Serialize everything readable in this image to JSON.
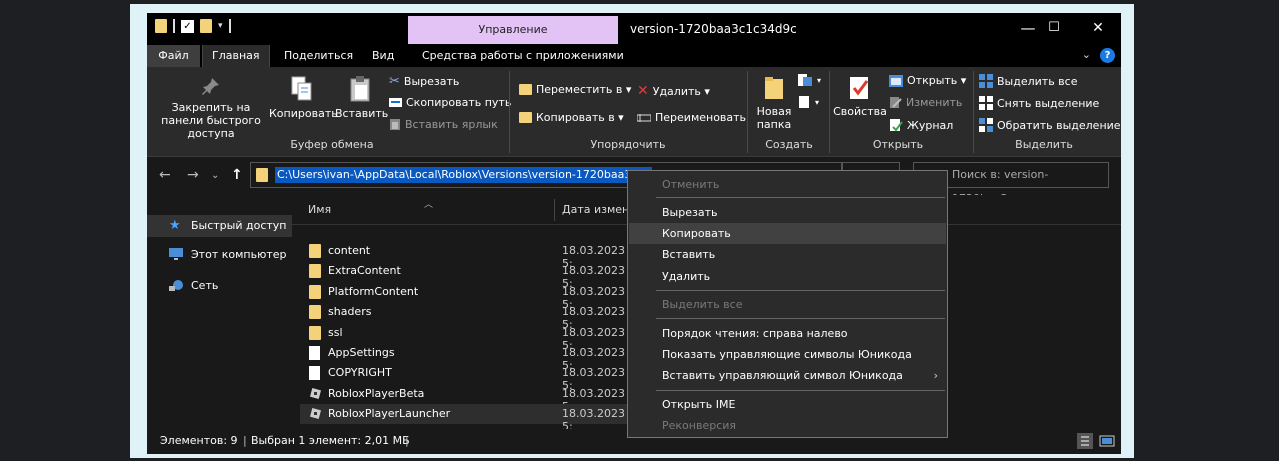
{
  "window": {
    "title": "version-1720baa3c1c34d9c",
    "context_tab_header": "Управление",
    "controls": {
      "minimize": "—",
      "maximize": "☐",
      "close": "✕"
    }
  },
  "tabs": [
    {
      "label": "Файл"
    },
    {
      "label": "Главная"
    },
    {
      "label": "Поделиться"
    },
    {
      "label": "Вид"
    },
    {
      "label": "Средства работы с приложениями"
    }
  ],
  "ribbon": {
    "clipboard": {
      "label": "Буфер обмена",
      "pin": "Закрепить на панели быстрого доступа",
      "copy": "Копировать",
      "paste": "Вставить",
      "cut": "Вырезать",
      "copy_path": "Скопировать путь",
      "paste_shortcut": "Вставить ярлык"
    },
    "organize": {
      "label": "Упорядочить",
      "move_to": "Переместить в ▾",
      "copy_to": "Копировать в ▾",
      "delete": "Удалить ▾",
      "rename": "Переименовать"
    },
    "new": {
      "label": "Создать",
      "new_folder": "Новая папка"
    },
    "open": {
      "label": "Открыть",
      "properties": "Свойства",
      "open": "Открыть ▾",
      "edit": "Изменить",
      "history": "Журнал"
    },
    "select": {
      "label": "Выделить",
      "select_all": "Выделить все",
      "select_none": "Снять выделение",
      "invert": "Обратить выделение"
    }
  },
  "address": {
    "path": "C:\\Users\\ivan-\\AppData\\Local\\Roblox\\Versions\\version-1720baa3c1c",
    "search_placeholder": "Поиск в: version-1720baa3c..."
  },
  "nav_pane": [
    {
      "label": "Быстрый доступ",
      "icon": "star-icon"
    },
    {
      "label": "Этот компьютер",
      "icon": "computer-icon"
    },
    {
      "label": "Сеть",
      "icon": "network-icon"
    }
  ],
  "columns": {
    "name": "Имя",
    "date": "Дата измене"
  },
  "files": [
    {
      "name": "content",
      "date": "18.03.2023 5:",
      "type": "folder"
    },
    {
      "name": "ExtraContent",
      "date": "18.03.2023 5:",
      "type": "folder"
    },
    {
      "name": "PlatformContent",
      "date": "18.03.2023 5:",
      "type": "folder"
    },
    {
      "name": "shaders",
      "date": "18.03.2023 5:",
      "type": "folder"
    },
    {
      "name": "ssl",
      "date": "18.03.2023 5:",
      "type": "folder"
    },
    {
      "name": "AppSettings",
      "date": "18.03.2023 5:",
      "type": "file"
    },
    {
      "name": "COPYRIGHT",
      "date": "18.03.2023 5:",
      "type": "file"
    },
    {
      "name": "RobloxPlayerBeta",
      "date": "18.03.2023 5:",
      "type": "exe"
    },
    {
      "name": "RobloxPlayerLauncher",
      "date": "18.03.2023 5:",
      "type": "exe"
    }
  ],
  "status": {
    "count": "Элементов: 9",
    "selected": "Выбран 1 элемент: 2,01 МБ"
  },
  "context_menu": {
    "undo": "Отменить",
    "cut": "Вырезать",
    "copy": "Копировать",
    "paste": "Вставить",
    "delete": "Удалить",
    "select_all": "Выделить все",
    "rtl": "Порядок чтения: справа налево",
    "show_unicode": "Показать управляющие символы Юникода",
    "insert_unicode": "Вставить управляющий символ Юникода",
    "submenu_arrow": "›",
    "open_ime": "Открыть IME",
    "reconversion": "Реконверсия"
  },
  "colors": {
    "selection": "#0a59c0",
    "context_tab": "#e3c2f5",
    "folder": "#f4d27a",
    "frame": "#dff2f7"
  }
}
